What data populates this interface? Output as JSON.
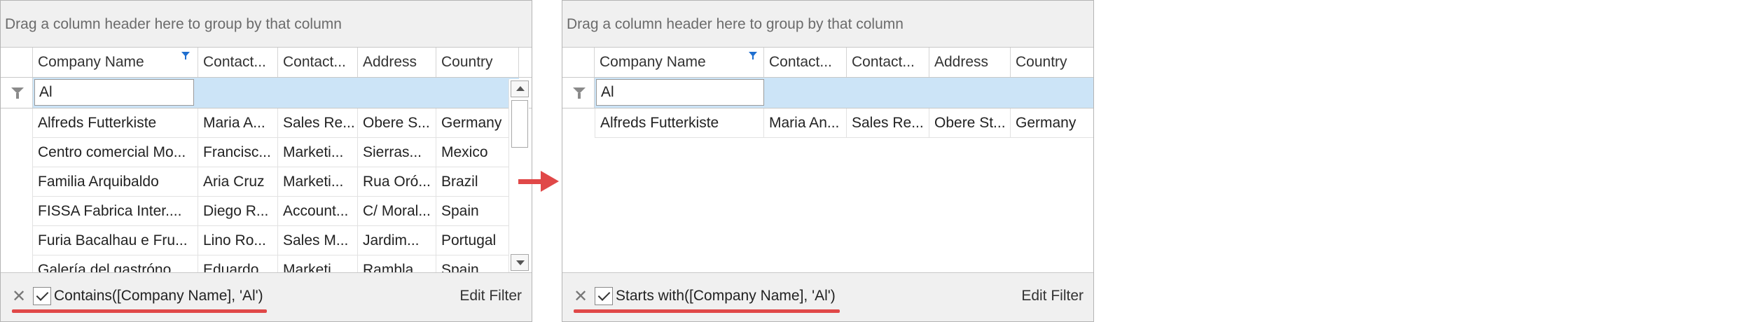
{
  "group_panel_text": "Drag a column header here to group by that column",
  "columns": [
    "Company Name",
    "Contact...",
    "Contact...",
    "Address",
    "Country"
  ],
  "left_grid": {
    "auto_filter_value": "Al",
    "rows": [
      [
        "Alfreds Futterkiste",
        "Maria A...",
        "Sales Re...",
        "Obere S...",
        "Germany"
      ],
      [
        "Centro comercial Mo...",
        "Francisc...",
        "Marketi...",
        "Sierras...",
        "Mexico"
      ],
      [
        "Familia Arquibaldo",
        "Aria Cruz",
        "Marketi...",
        "Rua Oró...",
        "Brazil"
      ],
      [
        "FISSA Fabrica Inter....",
        "Diego R...",
        "Account...",
        "C/ Moral...",
        "Spain"
      ],
      [
        "Furia Bacalhau e Fru...",
        "Lino Ro...",
        "Sales M...",
        "Jardim...",
        "Portugal"
      ],
      [
        "Galería del gastróno...",
        "Eduardo...",
        "Marketi...",
        "Rambla...",
        "Spain"
      ]
    ],
    "filter_expression": "Contains([Company Name], 'Al')",
    "edit_filter_label": "Edit Filter",
    "filter_enabled": true
  },
  "right_grid": {
    "auto_filter_value": "Al",
    "rows": [
      [
        "Alfreds Futterkiste",
        "Maria An...",
        "Sales Re...",
        "Obere St...",
        "Germany"
      ]
    ],
    "filter_expression": "Starts with([Company Name], 'Al')",
    "edit_filter_label": "Edit Filter",
    "filter_enabled": true
  },
  "close_glyph": "✕",
  "colors": {
    "accent_blue": "#1f6fd0",
    "auto_filter_row": "#cce4f7",
    "highlight_red": "#e04848"
  },
  "icons": {
    "auto_filter_row": "funnel-icon",
    "column_filter": "filter-applied-icon",
    "clear_filter": "close-icon",
    "transition": "right-arrow-icon"
  }
}
